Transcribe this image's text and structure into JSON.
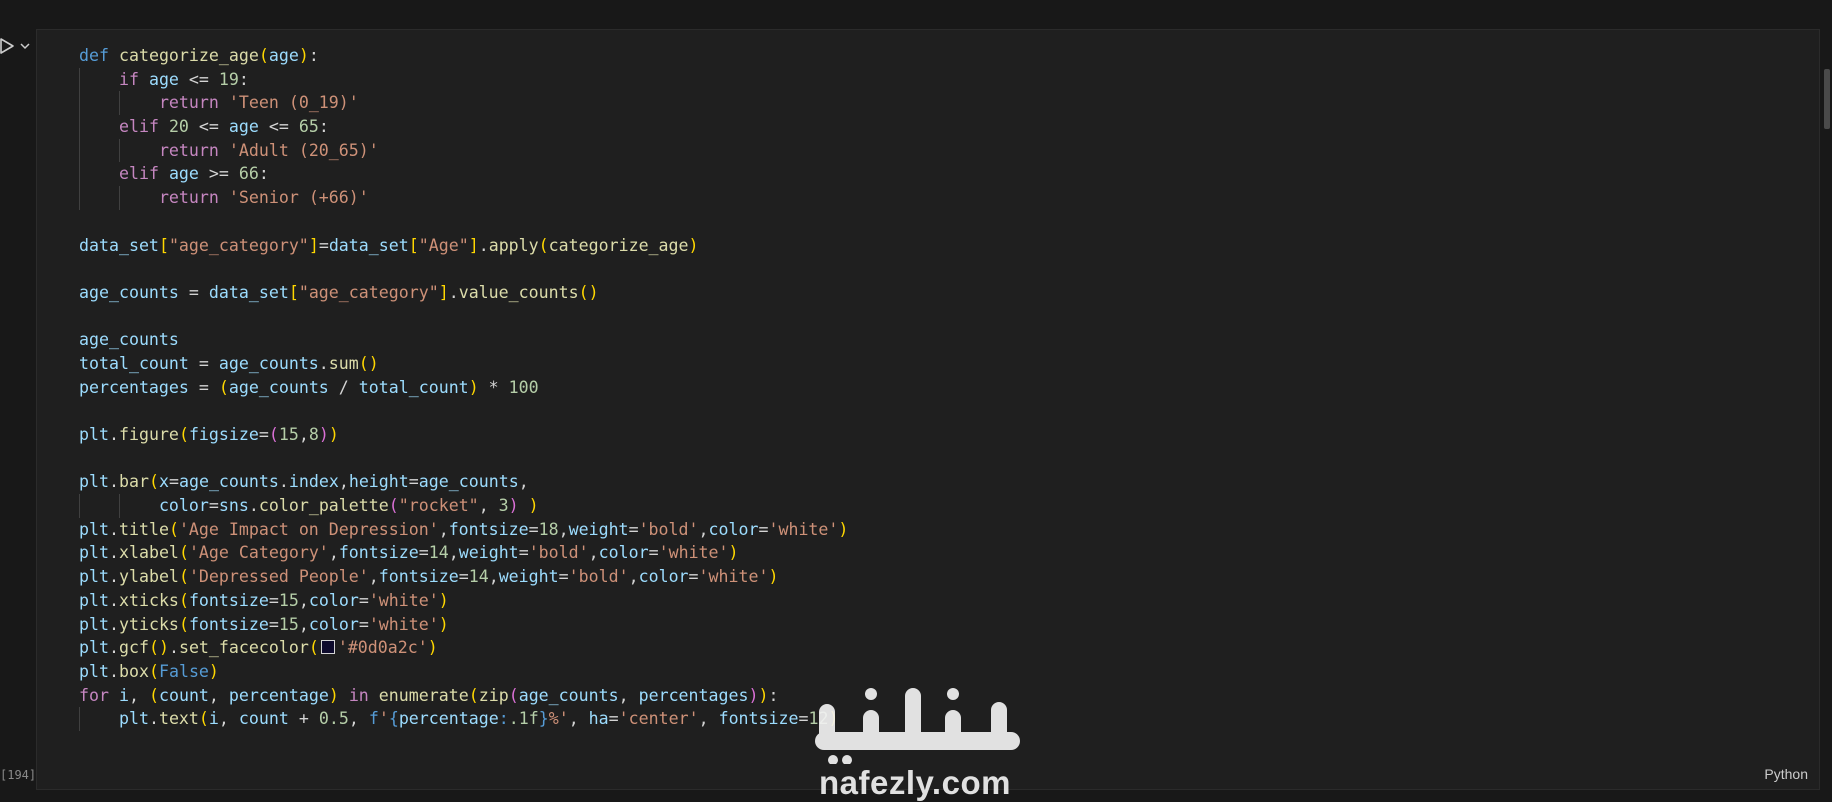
{
  "editor": {
    "execution_count": "[194]",
    "language": "Python",
    "code_line_count": 29
  },
  "watermark": {
    "arabic": "نفذلي",
    "domain": "nafezly.com"
  },
  "colors": {
    "background": "#181818",
    "cell_background": "#1f1f1f",
    "keyword": "#569cd6",
    "control_keyword": "#c586c0",
    "function": "#dcdcaa",
    "variable": "#9cdcfe",
    "string": "#ce9178",
    "number": "#b5cea8",
    "bracket_1": "#ffd700",
    "bracket_2": "#da70d6",
    "bracket_3": "#179fff",
    "facecolor_swatch": "#0d0a2c"
  },
  "icons": [
    "run-cell-icon",
    "chevron-down-icon"
  ]
}
